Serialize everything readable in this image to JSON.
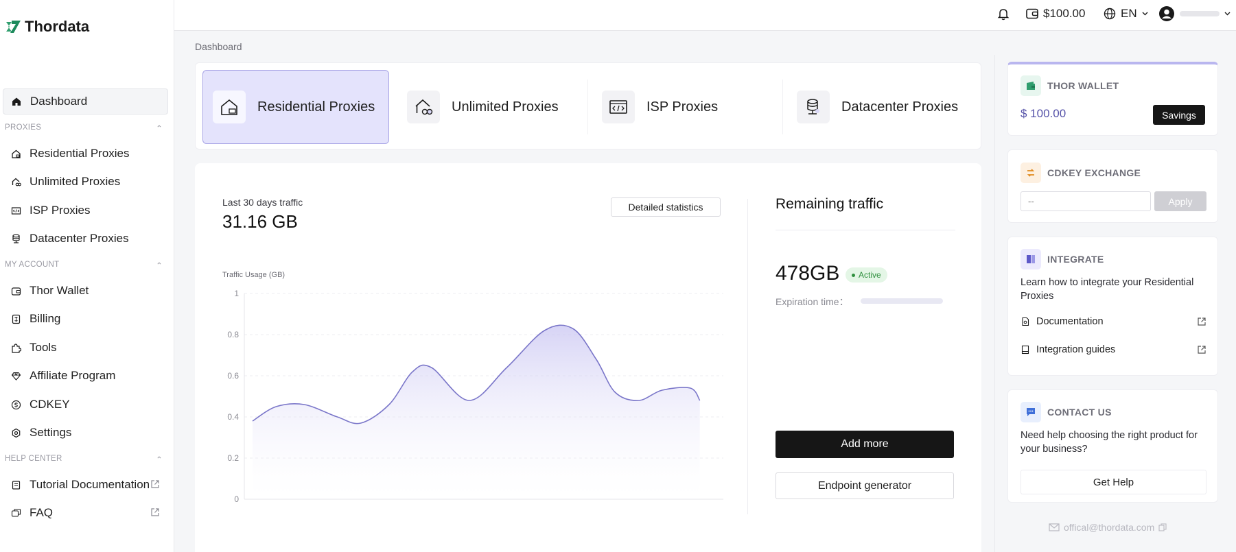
{
  "brand": {
    "name": "Thordata"
  },
  "topbar": {
    "balance": "$100.00",
    "language": "EN"
  },
  "sidebar": {
    "dashboard": "Dashboard",
    "sections": {
      "proxies": "PROXIES",
      "my_account": "MY ACCOUNT",
      "help_center": "HELP CENTER"
    },
    "proxies": [
      {
        "label": "Residential Proxies",
        "icon": "home-icon"
      },
      {
        "label": "Unlimited Proxies",
        "icon": "home-infinity-icon"
      },
      {
        "label": "ISP Proxies",
        "icon": "code-icon"
      },
      {
        "label": "Datacenter Proxies",
        "icon": "database-icon"
      }
    ],
    "account": [
      {
        "label": "Thor Wallet",
        "icon": "wallet-icon"
      },
      {
        "label": "Billing",
        "icon": "bill-icon"
      },
      {
        "label": "Tools",
        "icon": "puzzle-icon"
      },
      {
        "label": "Affiliate Program",
        "icon": "diamond-icon"
      },
      {
        "label": "CDKEY",
        "icon": "coin-icon"
      },
      {
        "label": "Settings",
        "icon": "gear-icon"
      }
    ],
    "help": [
      {
        "label": "Tutorial Documentation",
        "icon": "book-icon"
      },
      {
        "label": "FAQ",
        "icon": "faq-icon"
      }
    ]
  },
  "breadcrumb": "Dashboard",
  "tabs": [
    {
      "label": "Residential Proxies",
      "active": true
    },
    {
      "label": "Unlimited Proxies",
      "active": false
    },
    {
      "label": "ISP Proxies",
      "active": false
    },
    {
      "label": "Datacenter Proxies",
      "active": false
    }
  ],
  "traffic": {
    "label": "Last 30 days traffic",
    "value": "31.16 GB",
    "detailed_button": "Detailed statistics"
  },
  "chart_data": {
    "type": "area",
    "title": "",
    "ylabel": "Traffic Usage (GB)",
    "xlabel": "",
    "ylim": [
      0,
      1
    ],
    "yticks": [
      "1",
      "0.8",
      "0.6",
      "0.4",
      "0.2",
      "0"
    ],
    "grid": true,
    "series": [
      {
        "x": [
          0,
          0.05,
          0.11,
          0.18,
          0.23,
          0.29,
          0.34,
          0.38,
          0.46,
          0.54,
          0.62,
          0.68,
          0.73,
          0.77,
          0.82,
          0.87,
          0.93,
          0.95
        ],
        "values": [
          0.38,
          0.45,
          0.46,
          0.4,
          0.37,
          0.46,
          0.62,
          0.64,
          0.48,
          0.64,
          0.82,
          0.83,
          0.68,
          0.52,
          0.48,
          0.53,
          0.54,
          0.48
        ]
      }
    ]
  },
  "remaining": {
    "title": "Remaining traffic",
    "value": "478GB",
    "status": "Active",
    "expiration_label": "Expiration time：",
    "add_more": "Add more",
    "endpoint": "Endpoint generator"
  },
  "wallet": {
    "title": "THOR WALLET",
    "amount": "$ 100.00",
    "savings": "Savings"
  },
  "cdkey": {
    "title": "CDKEY EXCHANGE",
    "placeholder": "--",
    "apply": "Apply"
  },
  "integrate": {
    "title": "INTEGRATE",
    "description": "Learn how to integrate your Residential Proxies",
    "links": [
      "Documentation",
      "Integration guides"
    ]
  },
  "contact": {
    "title": "CONTACT US",
    "description": "Need help choosing the right product for your business?",
    "button": "Get Help",
    "email": "offical@thordata.com"
  },
  "colors": {
    "accent": "#7a76c9",
    "active_tab_bg": "#e4e3fc",
    "brand_green": "#2f9e6e"
  }
}
